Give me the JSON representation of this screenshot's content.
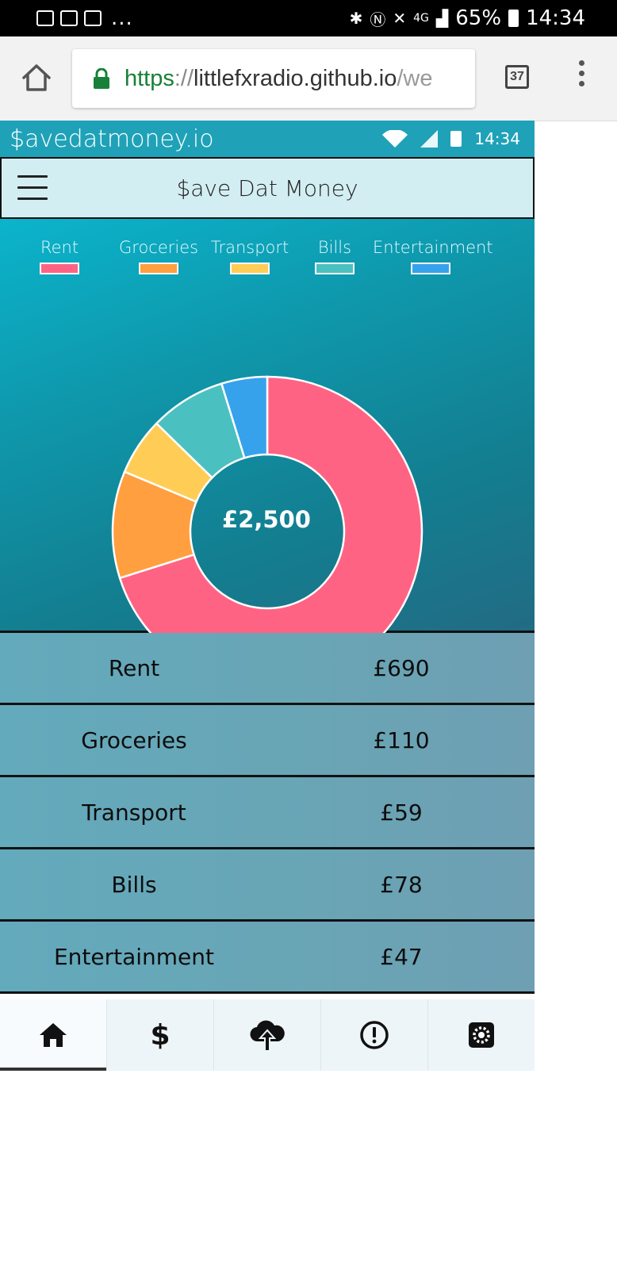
{
  "phone_status": {
    "battery": "65%",
    "time": "14:34",
    "network": "4G",
    "more": "..."
  },
  "browser": {
    "url_scheme": "https",
    "url_sep": "://",
    "url_host": "littlefxradio.github.io",
    "url_path": "/we",
    "tab_count": "37"
  },
  "app": {
    "status_title": "$avedatmoney.io",
    "status_time": "14:34",
    "header_title": "$ave Dat Money"
  },
  "chart_data": {
    "type": "pie",
    "title": "",
    "center_label": "£2,500",
    "categories": [
      "Rent",
      "Groceries",
      "Transport",
      "Bills",
      "Entertainment"
    ],
    "values": [
      690,
      110,
      59,
      78,
      47
    ],
    "colors": [
      "#ff6384",
      "#ff9f40",
      "#ffcd56",
      "#4bc0c0",
      "#36a2eb"
    ],
    "legend_position": "top"
  },
  "expenses": [
    {
      "name": "Rent",
      "amount": "£690"
    },
    {
      "name": "Groceries",
      "amount": "£110"
    },
    {
      "name": "Transport",
      "amount": "£59"
    },
    {
      "name": "Bills",
      "amount": "£78"
    },
    {
      "name": "Entertainment",
      "amount": "£47"
    }
  ],
  "nav": {
    "items": [
      {
        "icon": "home-icon",
        "active": true
      },
      {
        "icon": "dollar-icon",
        "label": "$",
        "active": false
      },
      {
        "icon": "cloud-upload-icon",
        "active": false
      },
      {
        "icon": "alert-icon",
        "active": false
      },
      {
        "icon": "settings-icon",
        "active": false
      }
    ]
  }
}
